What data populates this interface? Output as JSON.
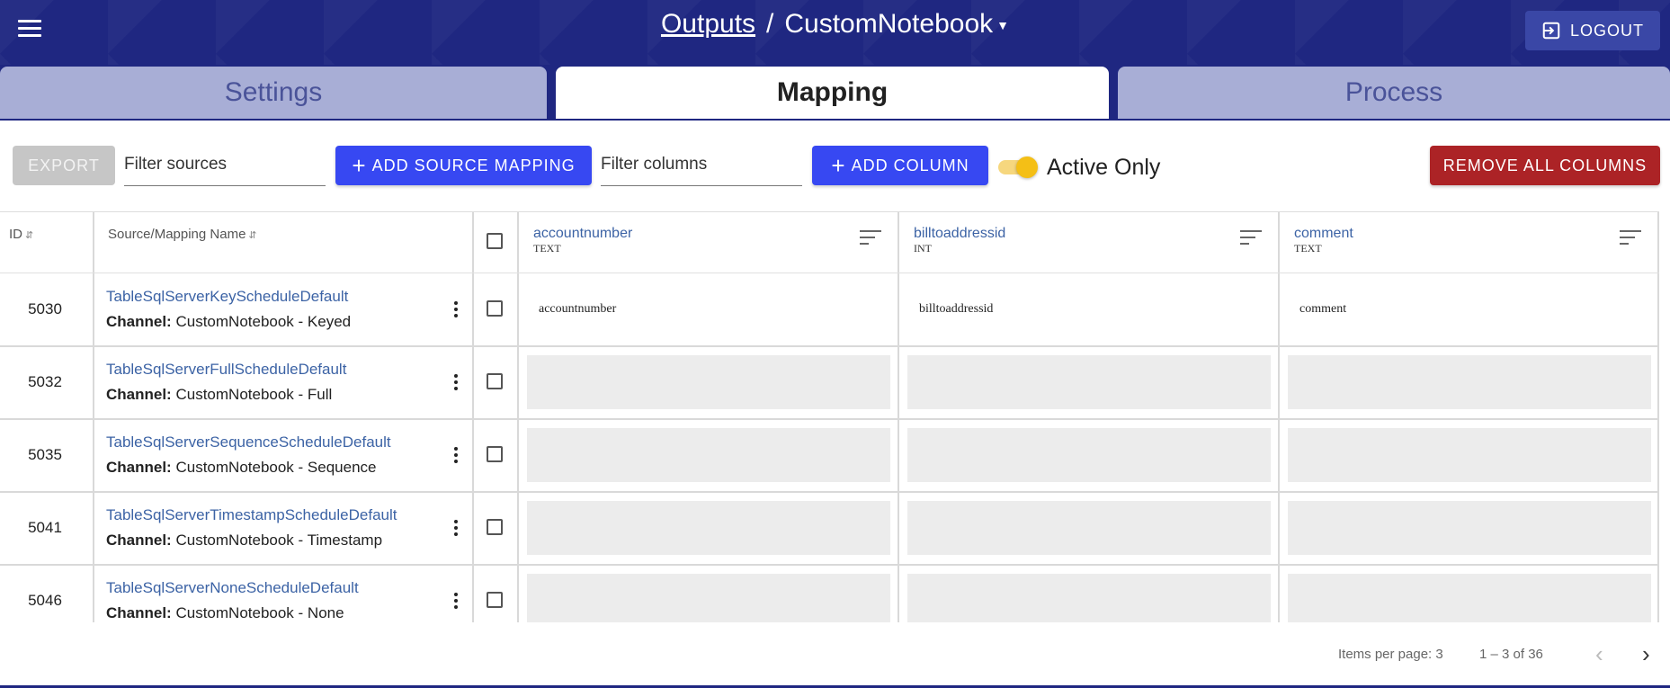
{
  "header": {
    "breadcrumb_root": "Outputs",
    "breadcrumb_separator": "/",
    "breadcrumb_current": "CustomNotebook",
    "logout_label": "LOGOUT"
  },
  "tabs": [
    {
      "label": "Settings",
      "active": false
    },
    {
      "label": "Mapping",
      "active": true
    },
    {
      "label": "Process",
      "active": false
    }
  ],
  "toolbar": {
    "export_label": "EXPORT",
    "filter_sources_placeholder": "Filter sources",
    "add_source_mapping_label": "ADD SOURCE MAPPING",
    "filter_columns_placeholder": "Filter columns",
    "add_column_label": "ADD COLUMN",
    "active_only_label": "Active Only",
    "active_only_on": true,
    "remove_all_label": "REMOVE ALL COLUMNS"
  },
  "table": {
    "headers": {
      "id": "ID",
      "name": "Source/Mapping Name"
    },
    "columns": [
      {
        "name": "accountnumber",
        "type": "TEXT"
      },
      {
        "name": "billtoaddressid",
        "type": "INT"
      },
      {
        "name": "comment",
        "type": "TEXT"
      }
    ],
    "channel_label": "Channel:",
    "rows": [
      {
        "id": "5030",
        "name": "TableSqlServerKeyScheduleDefault",
        "channel": "CustomNotebook - Keyed",
        "mappings": [
          "accountnumber",
          "billtoaddressid",
          "comment"
        ]
      },
      {
        "id": "5032",
        "name": "TableSqlServerFullScheduleDefault",
        "channel": "CustomNotebook - Full",
        "mappings": []
      },
      {
        "id": "5035",
        "name": "TableSqlServerSequenceScheduleDefault",
        "channel": "CustomNotebook - Sequence",
        "mappings": []
      },
      {
        "id": "5041",
        "name": "TableSqlServerTimestampScheduleDefault",
        "channel": "CustomNotebook - Timestamp",
        "mappings": []
      },
      {
        "id": "5046",
        "name": "TableSqlServerNoneScheduleDefault",
        "channel": "CustomNotebook - None",
        "mappings": []
      }
    ]
  },
  "paginator": {
    "items_per_page_label": "Items per page: 3",
    "range_label": "1 – 3 of 36"
  },
  "colors": {
    "header_bg": "#1f2781",
    "primary_button": "#3748f2",
    "danger_button": "#ac2326",
    "link": "#3c63a5",
    "toggle": "#f4bf16"
  }
}
